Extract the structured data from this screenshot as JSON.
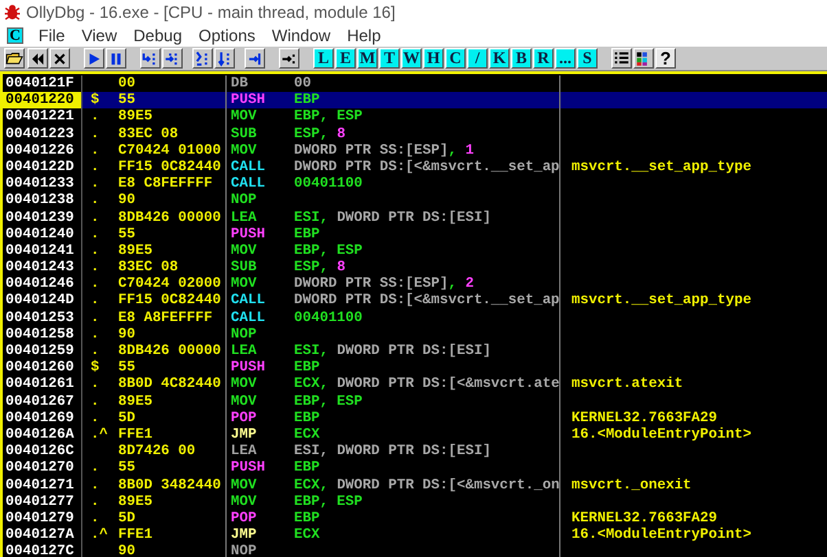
{
  "window": {
    "title": "OllyDbg - 16.exe - [CPU - main thread, module 16]"
  },
  "menu": {
    "window_button": "C",
    "items": [
      "File",
      "View",
      "Debug",
      "Options",
      "Window",
      "Help"
    ]
  },
  "toolbar": {
    "letter_buttons": [
      "L",
      "E",
      "M",
      "T",
      "W",
      "H",
      "C",
      "/",
      "K",
      "B",
      "R",
      "...",
      "S"
    ],
    "help_button": "?"
  },
  "rows": [
    {
      "address": "0040121F",
      "hex": "00",
      "mnemonic": "DB",
      "kind": "data",
      "selected": false,
      "operand": [
        {
          "text": "00",
          "kind": "memory"
        }
      ]
    },
    {
      "address": "00401220",
      "mark": "$",
      "hex": "55",
      "mnemonic": "PUSH",
      "kind": "stack",
      "selected": true,
      "operand": [
        {
          "text": "EBP",
          "kind": "register"
        }
      ]
    },
    {
      "address": "00401221",
      "mark": ".",
      "hex": "89E5",
      "mnemonic": "MOV",
      "kind": "plain",
      "selected": false,
      "operand": [
        {
          "text": "EBP, ESP",
          "kind": "register"
        }
      ]
    },
    {
      "address": "00401223",
      "mark": ".",
      "hex": "83EC 08",
      "mnemonic": "SUB",
      "kind": "plain",
      "selected": false,
      "operand": [
        {
          "text": "ESP, ",
          "kind": "register"
        },
        {
          "text": "8",
          "kind": "number"
        }
      ]
    },
    {
      "address": "00401226",
      "mark": ".",
      "hex": "C70424 01000",
      "mnemonic": "MOV",
      "kind": "plain",
      "selected": false,
      "operand": [
        {
          "text": "DWORD PTR SS:[ESP]",
          "kind": "memory"
        },
        {
          "text": ", ",
          "kind": "register"
        },
        {
          "text": "1",
          "kind": "number"
        }
      ]
    },
    {
      "address": "0040122D",
      "mark": ".",
      "hex": "FF15 0C82440",
      "mnemonic": "CALL",
      "kind": "call",
      "selected": false,
      "operand": [
        {
          "text": "DWORD PTR DS:[<&msvcrt.__set_ap",
          "kind": "memory"
        }
      ],
      "comment": "msvcrt.__set_app_type"
    },
    {
      "address": "00401233",
      "mark": ".",
      "hex": "E8 C8FEFFFF",
      "mnemonic": "CALL",
      "kind": "call",
      "selected": false,
      "operand": [
        {
          "text": "00401100",
          "kind": "register"
        }
      ]
    },
    {
      "address": "00401238",
      "mark": ".",
      "hex": "90",
      "mnemonic": "NOP",
      "kind": "plain",
      "selected": false,
      "operand": []
    },
    {
      "address": "00401239",
      "mark": ".",
      "hex": "8DB426 00000",
      "mnemonic": "LEA",
      "kind": "plain",
      "selected": false,
      "operand": [
        {
          "text": "ESI, ",
          "kind": "register"
        },
        {
          "text": "DWORD PTR DS:[ESI]",
          "kind": "memory"
        }
      ]
    },
    {
      "address": "00401240",
      "mark": ".",
      "hex": "55",
      "mnemonic": "PUSH",
      "kind": "stack",
      "selected": false,
      "operand": [
        {
          "text": "EBP",
          "kind": "register"
        }
      ]
    },
    {
      "address": "00401241",
      "mark": ".",
      "hex": "89E5",
      "mnemonic": "MOV",
      "kind": "plain",
      "selected": false,
      "operand": [
        {
          "text": "EBP, ESP",
          "kind": "register"
        }
      ]
    },
    {
      "address": "00401243",
      "mark": ".",
      "hex": "83EC 08",
      "mnemonic": "SUB",
      "kind": "plain",
      "selected": false,
      "operand": [
        {
          "text": "ESP, ",
          "kind": "register"
        },
        {
          "text": "8",
          "kind": "number"
        }
      ]
    },
    {
      "address": "00401246",
      "mark": ".",
      "hex": "C70424 02000",
      "mnemonic": "MOV",
      "kind": "plain",
      "selected": false,
      "operand": [
        {
          "text": "DWORD PTR SS:[ESP]",
          "kind": "memory"
        },
        {
          "text": ", ",
          "kind": "register"
        },
        {
          "text": "2",
          "kind": "number"
        }
      ]
    },
    {
      "address": "0040124D",
      "mark": ".",
      "hex": "FF15 0C82440",
      "mnemonic": "CALL",
      "kind": "call",
      "selected": false,
      "operand": [
        {
          "text": "DWORD PTR DS:[<&msvcrt.__set_ap",
          "kind": "memory"
        }
      ],
      "comment": "msvcrt.__set_app_type"
    },
    {
      "address": "00401253",
      "mark": ".",
      "hex": "E8 A8FEFFFF",
      "mnemonic": "CALL",
      "kind": "call",
      "selected": false,
      "operand": [
        {
          "text": "00401100",
          "kind": "register"
        }
      ]
    },
    {
      "address": "00401258",
      "mark": ".",
      "hex": "90",
      "mnemonic": "NOP",
      "kind": "plain",
      "selected": false,
      "operand": []
    },
    {
      "address": "00401259",
      "mark": ".",
      "hex": "8DB426 00000",
      "mnemonic": "LEA",
      "kind": "plain",
      "selected": false,
      "operand": [
        {
          "text": "ESI, ",
          "kind": "register"
        },
        {
          "text": "DWORD PTR DS:[ESI]",
          "kind": "memory"
        }
      ]
    },
    {
      "address": "00401260",
      "mark": "$",
      "hex": "55",
      "mnemonic": "PUSH",
      "kind": "stack",
      "selected": false,
      "operand": [
        {
          "text": "EBP",
          "kind": "register"
        }
      ]
    },
    {
      "address": "00401261",
      "mark": ".",
      "hex": "8B0D 4C82440",
      "mnemonic": "MOV",
      "kind": "plain",
      "selected": false,
      "operand": [
        {
          "text": "ECX, ",
          "kind": "register"
        },
        {
          "text": "DWORD PTR DS:[<&msvcrt.ate",
          "kind": "memory"
        }
      ],
      "comment": "msvcrt.atexit"
    },
    {
      "address": "00401267",
      "mark": ".",
      "hex": "89E5",
      "mnemonic": "MOV",
      "kind": "plain",
      "selected": false,
      "operand": [
        {
          "text": "EBP, ESP",
          "kind": "register"
        }
      ]
    },
    {
      "address": "00401269",
      "mark": ".",
      "hex": "5D",
      "mnemonic": "POP",
      "kind": "stack",
      "selected": false,
      "operand": [
        {
          "text": "EBP",
          "kind": "register"
        }
      ],
      "comment": "KERNEL32.7663FA29"
    },
    {
      "address": "0040126A",
      "mark": ".^",
      "hex": "FFE1",
      "mnemonic": "JMP",
      "kind": "jump",
      "selected": false,
      "operand": [
        {
          "text": "ECX",
          "kind": "register"
        }
      ],
      "comment": "16.<ModuleEntryPoint>"
    },
    {
      "address": "0040126C",
      "hex": "8D7426 00",
      "mnemonic": "LEA",
      "kind": "data",
      "selected": false,
      "operand": [
        {
          "text": "ESI, ",
          "kind": "memory"
        },
        {
          "text": "DWORD PTR DS:[ESI]",
          "kind": "memory"
        }
      ]
    },
    {
      "address": "00401270",
      "mark": ".",
      "hex": "55",
      "mnemonic": "PUSH",
      "kind": "stack",
      "selected": false,
      "operand": [
        {
          "text": "EBP",
          "kind": "register"
        }
      ]
    },
    {
      "address": "00401271",
      "mark": ".",
      "hex": "8B0D 3482440",
      "mnemonic": "MOV",
      "kind": "plain",
      "selected": false,
      "operand": [
        {
          "text": "ECX, ",
          "kind": "register"
        },
        {
          "text": "DWORD PTR DS:[<&msvcrt._on",
          "kind": "memory"
        }
      ],
      "comment": "msvcrt._onexit"
    },
    {
      "address": "00401277",
      "mark": ".",
      "hex": "89E5",
      "mnemonic": "MOV",
      "kind": "plain",
      "selected": false,
      "operand": [
        {
          "text": "EBP, ESP",
          "kind": "register"
        }
      ]
    },
    {
      "address": "00401279",
      "mark": ".",
      "hex": "5D",
      "mnemonic": "POP",
      "kind": "stack",
      "selected": false,
      "operand": [
        {
          "text": "EBP",
          "kind": "register"
        }
      ],
      "comment": "KERNEL32.7663FA29"
    },
    {
      "address": "0040127A",
      "mark": ".^",
      "hex": "FFE1",
      "mnemonic": "JMP",
      "kind": "jump",
      "selected": false,
      "operand": [
        {
          "text": "ECX",
          "kind": "register"
        }
      ],
      "comment": "16.<ModuleEntryPoint>"
    },
    {
      "address": "0040127C",
      "hex": "90",
      "mnemonic": "NOP",
      "kind": "data",
      "selected": false,
      "operand": []
    }
  ]
}
